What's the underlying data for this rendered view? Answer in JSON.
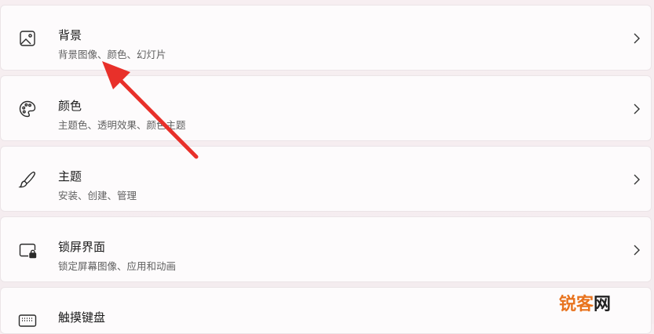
{
  "settings": {
    "items": [
      {
        "title": "背景",
        "subtitle": "背景图像、颜色、幻灯片",
        "icon": "image-icon"
      },
      {
        "title": "颜色",
        "subtitle": "主题色、透明效果、颜色主题",
        "icon": "palette-icon"
      },
      {
        "title": "主题",
        "subtitle": "安装、创建、管理",
        "icon": "brush-icon"
      },
      {
        "title": "锁屏界面",
        "subtitle": "锁定屏幕图像、应用和动画",
        "icon": "lock-screen-icon"
      },
      {
        "title": "触摸键盘",
        "subtitle": "",
        "icon": "keyboard-icon"
      }
    ]
  },
  "watermark": {
    "part1": "锐",
    "part2": "客",
    "part3": "网"
  },
  "colors": {
    "arrow": "#e8302a",
    "watermark_orange": "#e8731e",
    "watermark_dark": "#222222"
  }
}
